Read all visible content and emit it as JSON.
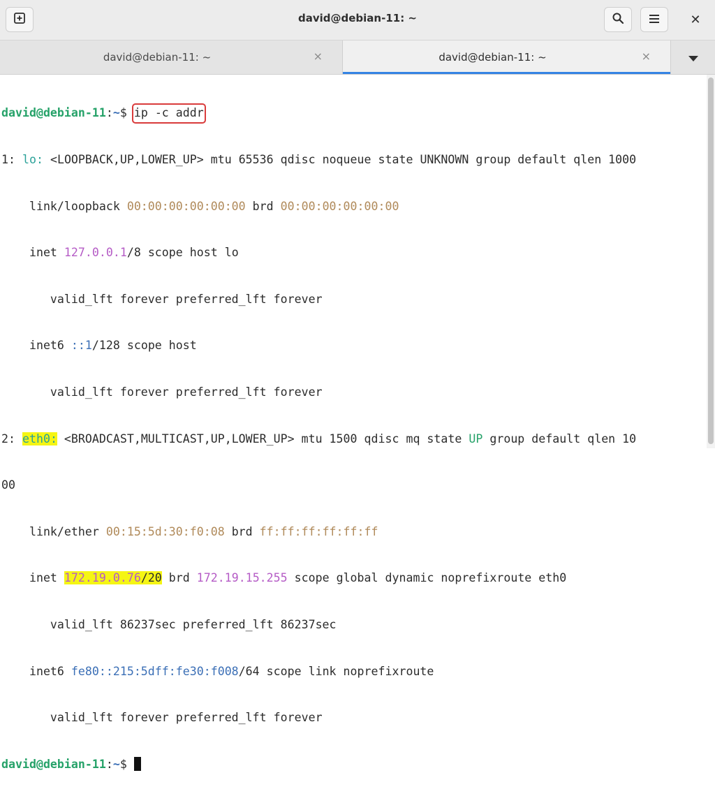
{
  "window": {
    "title": "david@debian-11: ~",
    "new_tab_icon": "new-tab-icon",
    "search_icon": "search-icon",
    "menu_icon": "hamburger-menu-icon",
    "close_label": "✕"
  },
  "tabs": [
    {
      "label": "david@debian-11: ~",
      "close": "×",
      "active": false
    },
    {
      "label": "david@debian-11: ~",
      "close": "×",
      "active": true
    }
  ],
  "tab_overflow_icon": "chevron-down-icon",
  "colors": {
    "accent": "#3584e4",
    "prompt_user": "#26a269",
    "prompt_path": "#3b6fb6",
    "highlight": "#f5f514",
    "command_box": "#d93b3b"
  },
  "terminal": {
    "prompt_user": "david@debian-11",
    "prompt_sep": ":",
    "prompt_path": "~",
    "prompt_symbol": "$ ",
    "command": "ip -c addr",
    "l2": {
      "a": "1: ",
      "iface": "lo:",
      "b": " <LOOPBACK,UP,LOWER_UP> mtu 65536 qdisc noqueue state UNKNOWN group default qlen 1000"
    },
    "l3": {
      "a": "    link/loopback ",
      "mac": "00:00:00:00:00:00",
      "b": " brd ",
      "brd": "00:00:00:00:00:00"
    },
    "l4": {
      "a": "    inet ",
      "ip": "127.0.0.1",
      "b": "/8 scope host lo"
    },
    "l5": "       valid_lft forever preferred_lft forever",
    "l6": {
      "a": "    inet6 ",
      "ip": "::1",
      "b": "/128 scope host"
    },
    "l7": "       valid_lft forever preferred_lft forever",
    "l8": {
      "a": "2: ",
      "iface": "eth0:",
      "b": " <BROADCAST,MULTICAST,UP,LOWER_UP> mtu 1500 qdisc mq state ",
      "state": "UP",
      "c": " group default qlen 10"
    },
    "l9": "00",
    "l10": {
      "a": "    link/ether ",
      "mac": "00:15:5d:30:f0:08",
      "b": " brd ",
      "brd": "ff:ff:ff:ff:ff:ff"
    },
    "l11": {
      "a": "    inet ",
      "ip": "172.19.0.76",
      "mask": "/20",
      "b": " brd ",
      "brd": "172.19.15.255",
      "c": " scope global dynamic noprefixroute eth0"
    },
    "l12": "       valid_lft 86237sec preferred_lft 86237sec",
    "l13": {
      "a": "    inet6 ",
      "ip": "fe80::215:5dff:fe30:f008",
      "b": "/64 scope link noprefixroute"
    },
    "l14": "       valid_lft forever preferred_lft forever"
  }
}
